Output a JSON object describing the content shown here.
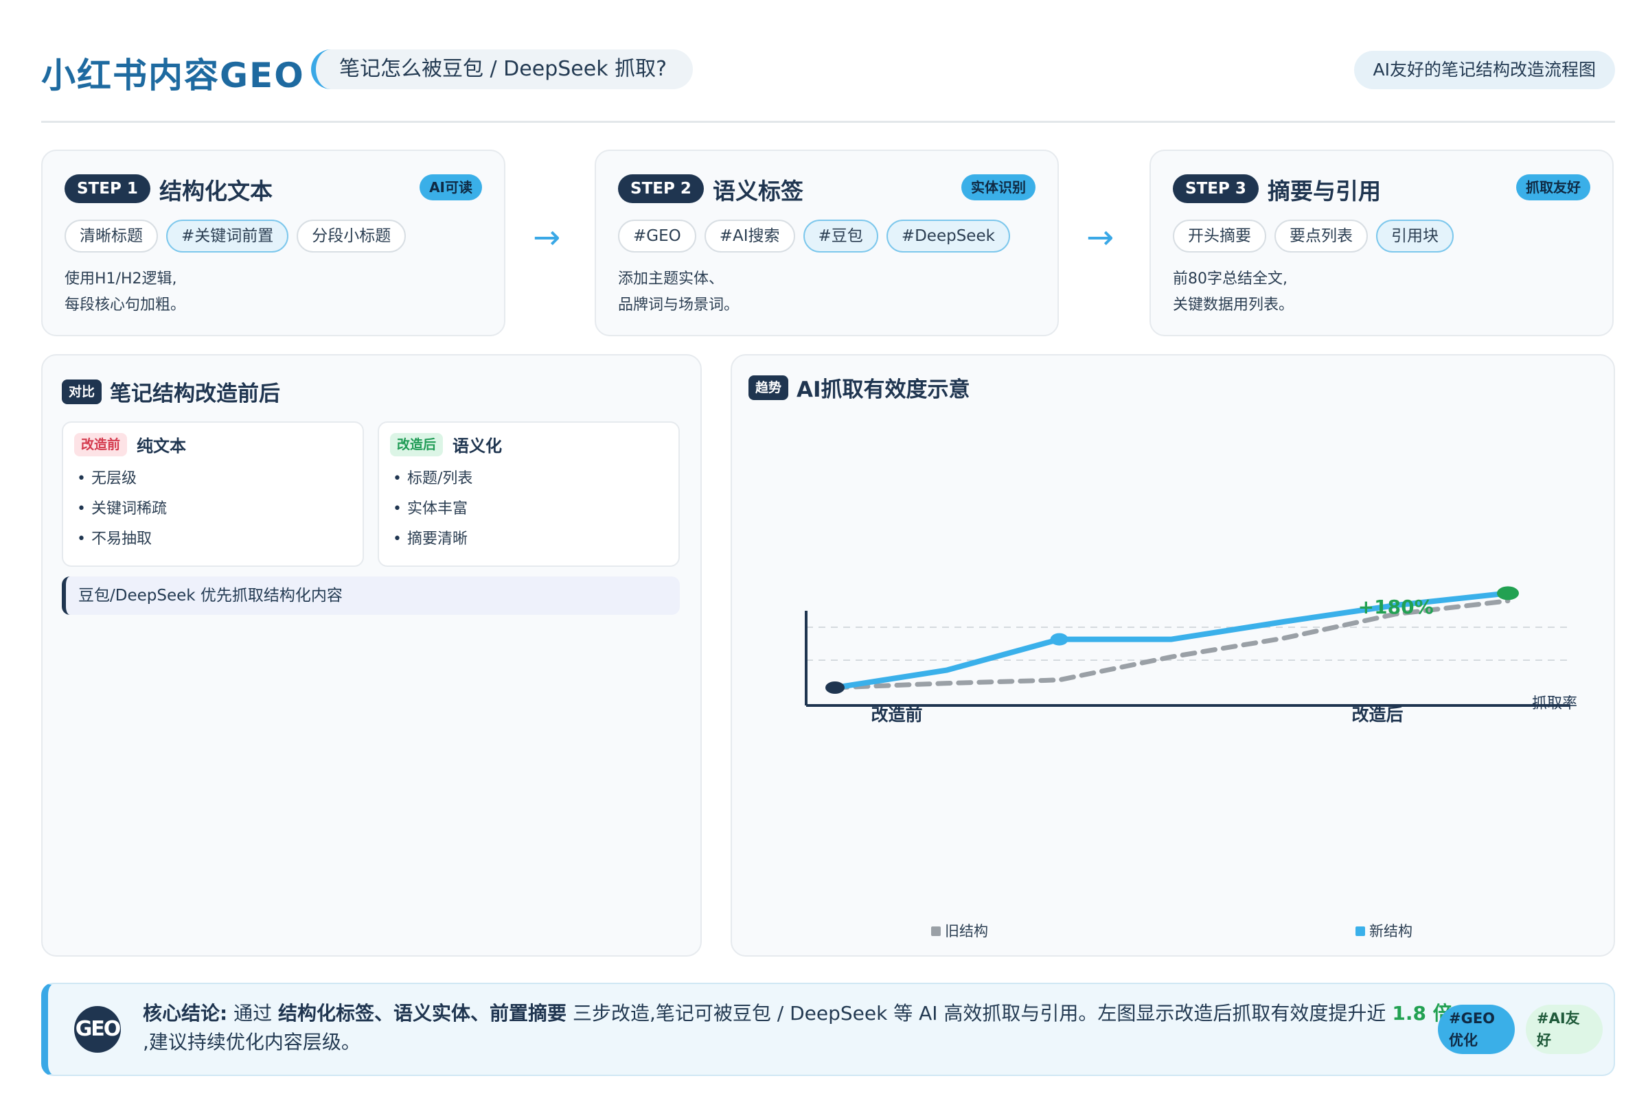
{
  "header": {
    "title": "小红书内容GEO",
    "subtitle": "笔记怎么被豆包 / DeepSeek 抓取?",
    "badge": "AI友好的笔记结构改造流程图"
  },
  "steps": [
    {
      "pill": "STEP 1",
      "title": "结构化文本",
      "badge": "AI可读",
      "tags": [
        {
          "text": "清晰标题"
        },
        {
          "text": "#关键词前置"
        },
        {
          "text": "分段小标题"
        }
      ],
      "desc1": "使用H1/H2逻辑,",
      "desc2": "每段核心句加粗。"
    },
    {
      "pill": "STEP 2",
      "title": "语义标签",
      "badge": "实体识别",
      "tags": [
        {
          "text": "#GEO"
        },
        {
          "text": "#AI搜索"
        },
        {
          "text": "#豆包"
        },
        {
          "text": "#DeepSeek"
        }
      ],
      "desc1": "添加主题实体、",
      "desc2": "品牌词与场景词。"
    },
    {
      "pill": "STEP 3",
      "title": "摘要与引用",
      "badge": "抓取友好",
      "tags": [
        {
          "text": "开头摘要"
        },
        {
          "text": "要点列表"
        },
        {
          "text": "引用块"
        }
      ],
      "desc1": "前80字总结全文,",
      "desc2": "关键数据用列表。"
    }
  ],
  "arrows": {
    "symbol": "→"
  },
  "compare": {
    "pill": "对比",
    "title": "笔记结构改造前后",
    "before": {
      "chip": "改造前",
      "name": "纯文本",
      "items": [
        "无层级",
        "关键词稀疏",
        "不易抽取"
      ]
    },
    "after": {
      "chip": "改造后",
      "name": "语义化",
      "items": [
        "标题/列表",
        "实体丰富",
        "摘要清晰"
      ]
    },
    "note": "豆包/DeepSeek 优先抓取结构化内容"
  },
  "trend": {
    "pill": "趋势",
    "title": "AI抓取有效度示意"
  },
  "chart_data": {
    "type": "line",
    "title": "AI抓取有效度示意",
    "xlabel": "",
    "ylabel": "抓取率",
    "x_tick_labels": [
      "改造前",
      "改造后"
    ],
    "x": [
      0,
      1,
      2,
      3,
      4,
      5,
      6
    ],
    "ylim": [
      0,
      1.0
    ],
    "grid": true,
    "legend_position": "bottom",
    "annotation": "+180%",
    "colors": {
      "old": "#9aa0a6",
      "new": "#3ab0ea",
      "start": "#1f3550",
      "end": "#22a152"
    },
    "series": [
      {
        "name": "旧结构",
        "style": "dashed",
        "values": [
          0.1,
          0.14,
          0.17,
          0.38,
          0.55,
          0.77,
          0.89
        ]
      },
      {
        "name": "新结构",
        "style": "solid",
        "values": [
          0.1,
          0.26,
          0.54,
          0.54,
          0.7,
          0.85,
          0.96
        ]
      }
    ]
  },
  "conclusion": {
    "logo": "GEO",
    "label": "核心结论:",
    "t1": "通过",
    "k1": "结构化标签、语义实体、前置摘要",
    "t2": "三步改造,笔记可被豆包 / DeepSeek 等 AI 高效抓取与引用。左图显示改造后抓取有效度提升近",
    "k2": "1.8 倍",
    "t3": ",建议持续优化内容层级。",
    "tag1": "#GEO优化",
    "tag2": "#AI友好"
  }
}
